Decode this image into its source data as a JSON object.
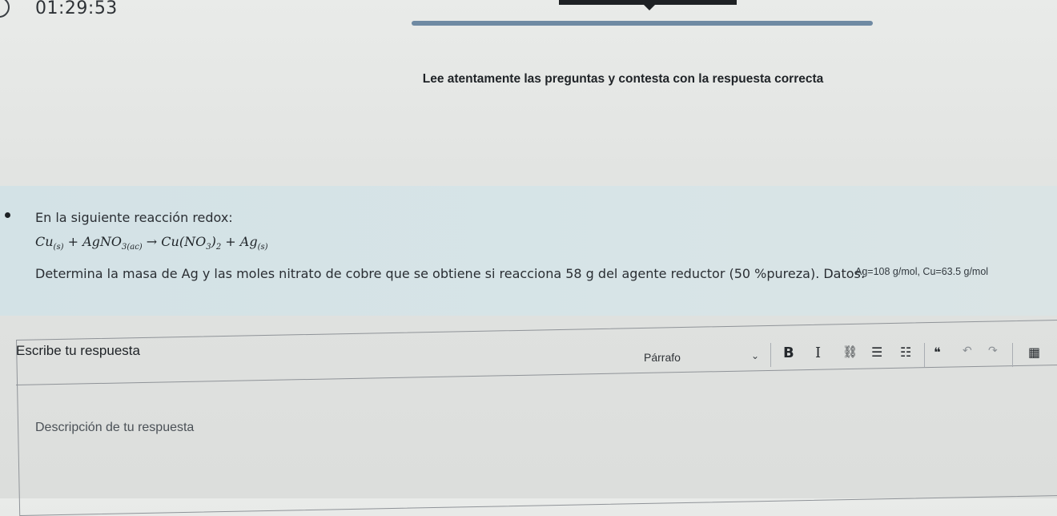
{
  "timer": {
    "value": "01:29:53",
    "icon": "clock-icon"
  },
  "progress": {
    "fraction": 1.0
  },
  "instructions": "Lee atentamente las preguntas y contesta con la respuesta correcta",
  "question": {
    "intro": "En la siguiente reacción redox:",
    "equation": {
      "cu": "Cu",
      "cu_sub": "(s)",
      "plus1": " + ",
      "agno3": "AgNO",
      "agno3_sub": "3(ac)",
      "arrow": " → ",
      "cuno3": "Cu(NO",
      "cuno3_sub3": "3",
      "cuno3_close": ")",
      "cuno3_sub2": "2",
      "plus2": " + ",
      "ag": "Ag",
      "ag_sub": "(s)"
    },
    "prompt": "Determina la masa de Ag y las moles nitrato de cobre que se obtiene si reacciona 58 g del agente reductor (50 %pureza). Datos:",
    "data_tail": "Ag=108 g/mol, Cu=63.5 g/mol"
  },
  "answer": {
    "label": "Escribe tu respuesta",
    "placeholder": "Descripción de tu respuesta"
  },
  "toolbar": {
    "paragraph_select": "Párrafo",
    "bold": "B",
    "italic": "I",
    "link_icon": "⛓",
    "bullet_list_icon": "☰",
    "numbered_list_icon": "☷",
    "quote_icon": "❝",
    "undo_icon": "↶",
    "redo_icon": "↷",
    "table_icon": "▦"
  }
}
